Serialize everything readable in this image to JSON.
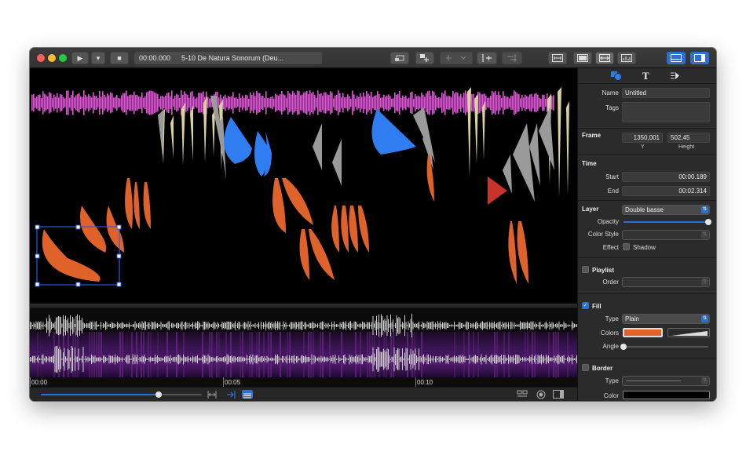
{
  "window": {
    "title_timecode": "00:00.000",
    "title_track": "5-10 De Natura Sonorum (Deu..."
  },
  "colors": {
    "accent": "#2f6fd1",
    "magenta": "#e055d8",
    "orange": "#e0622b",
    "cream": "#d9d2a0",
    "grey": "#9a9a9a",
    "blue": "#2f7df0",
    "red": "#c8332a"
  },
  "icons": {
    "play": "▶",
    "stop": "■",
    "dropdown": "▾",
    "text_tool": "T"
  },
  "ruler": {
    "ticks": [
      "00:00",
      "00:05",
      "00:10"
    ]
  },
  "playback": {
    "zoom_level": 0.73
  },
  "inspector": {
    "name_label": "Name",
    "name_value": "Untitled",
    "tags_label": "Tags",
    "frame_title": "Frame",
    "frame_x": "1350,001",
    "frame_y_label": "Y",
    "frame_height_value": "502,45",
    "frame_height_label": "Height",
    "time_title": "Time",
    "start_label": "Start",
    "start_value": "00:00.189",
    "end_label": "End",
    "end_value": "00:02.314",
    "layer_label": "Layer",
    "layer_value": "Double basse",
    "opacity_label": "Opacity",
    "opacity_level": 1.0,
    "color_style_label": "Color Style",
    "effect_label": "Effect",
    "shadow_label": "Shadow",
    "playlist_title": "Playlist",
    "order_label": "Order",
    "fill_title": "Fill",
    "fill_type_label": "Type",
    "fill_type_value": "Plain",
    "fill_colors_label": "Colors",
    "fill_color": "#e0622b",
    "angle_label": "Angle",
    "angle_level": 0.0,
    "border_title": "Border",
    "border_type_label": "Type",
    "border_color_label": "Color"
  }
}
